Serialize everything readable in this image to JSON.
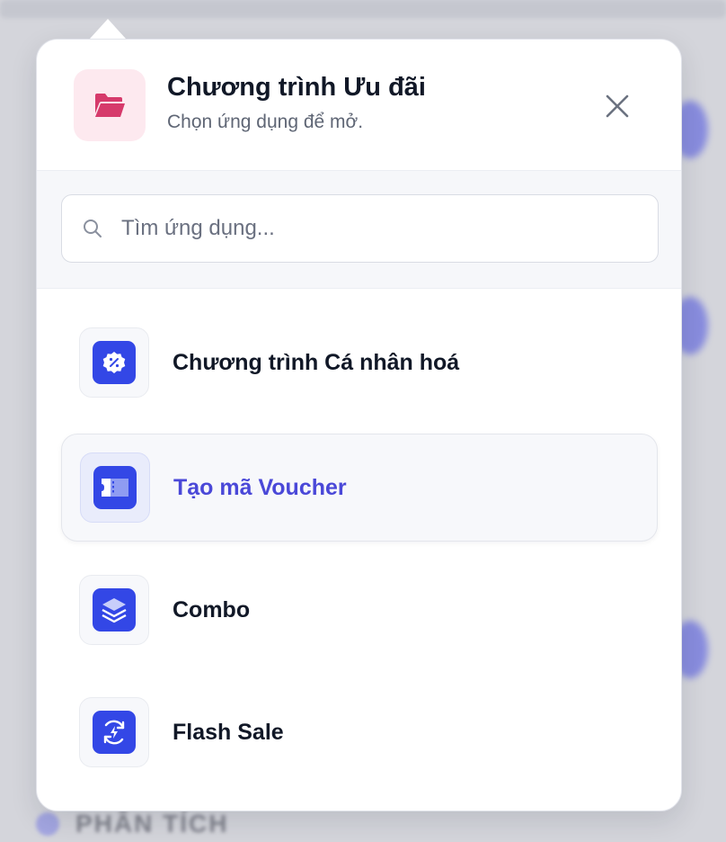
{
  "popover": {
    "title": "Chương trình Ưu đãi",
    "subtitle": "Chọn ứng dụng để mở.",
    "header_icon": "folder-open-icon",
    "close_icon": "close-icon"
  },
  "search": {
    "placeholder": "Tìm ứng dụng...",
    "value": ""
  },
  "apps": [
    {
      "label": "Chương trình Cá nhân hoá",
      "icon": "discount-badge-icon",
      "active": false
    },
    {
      "label": "Tạo mã Voucher",
      "icon": "voucher-ticket-icon",
      "active": true
    },
    {
      "label": "Combo",
      "icon": "layers-icon",
      "active": false
    },
    {
      "label": "Flash Sale",
      "icon": "refresh-bolt-icon",
      "active": false
    }
  ],
  "colors": {
    "accent": "#3347e6",
    "active_text": "#4a48d8",
    "header_icon_bg": "#fde9ef",
    "header_icon_fg": "#d63a6b"
  },
  "background": {
    "footer_label": "PHÂN TÍCH"
  }
}
